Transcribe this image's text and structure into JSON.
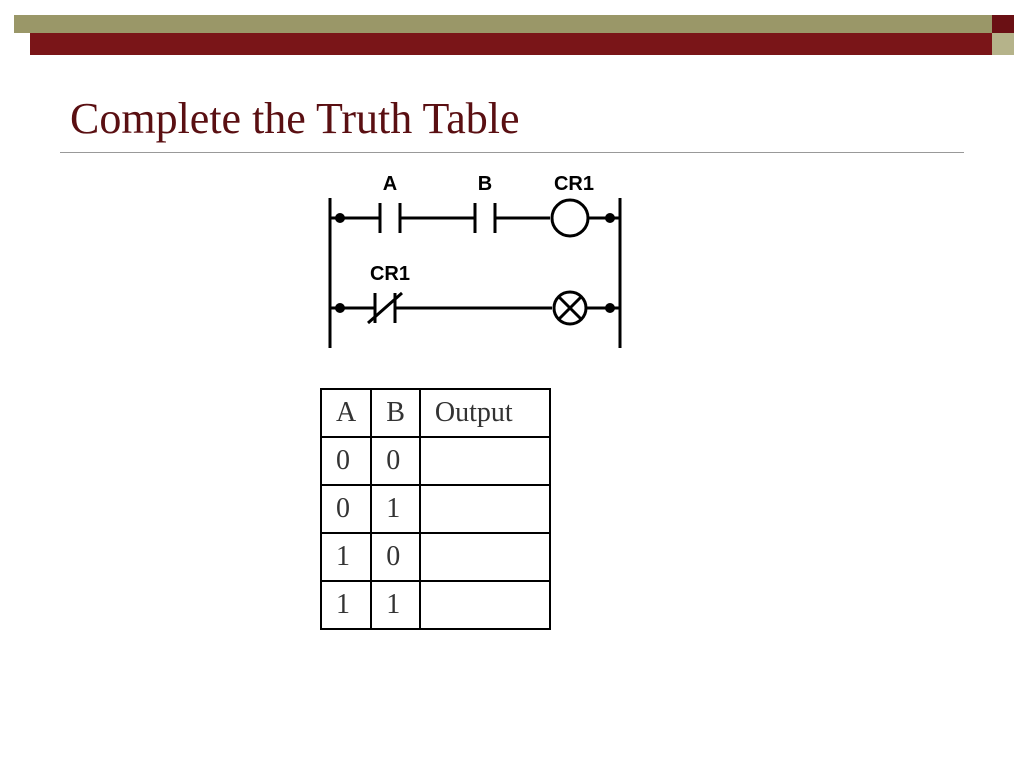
{
  "title": "Complete the Truth Table",
  "ladder": {
    "rung1": {
      "contact_a": "A",
      "contact_b": "B",
      "coil": "CR1"
    },
    "rung2": {
      "contact": "CR1"
    }
  },
  "table": {
    "headers": {
      "a": "A",
      "b": "B",
      "out": "Output"
    },
    "rows": [
      {
        "a": "0",
        "b": "0",
        "out": ""
      },
      {
        "a": "0",
        "b": "1",
        "out": ""
      },
      {
        "a": "1",
        "b": "0",
        "out": ""
      },
      {
        "a": "1",
        "b": "1",
        "out": ""
      }
    ]
  }
}
